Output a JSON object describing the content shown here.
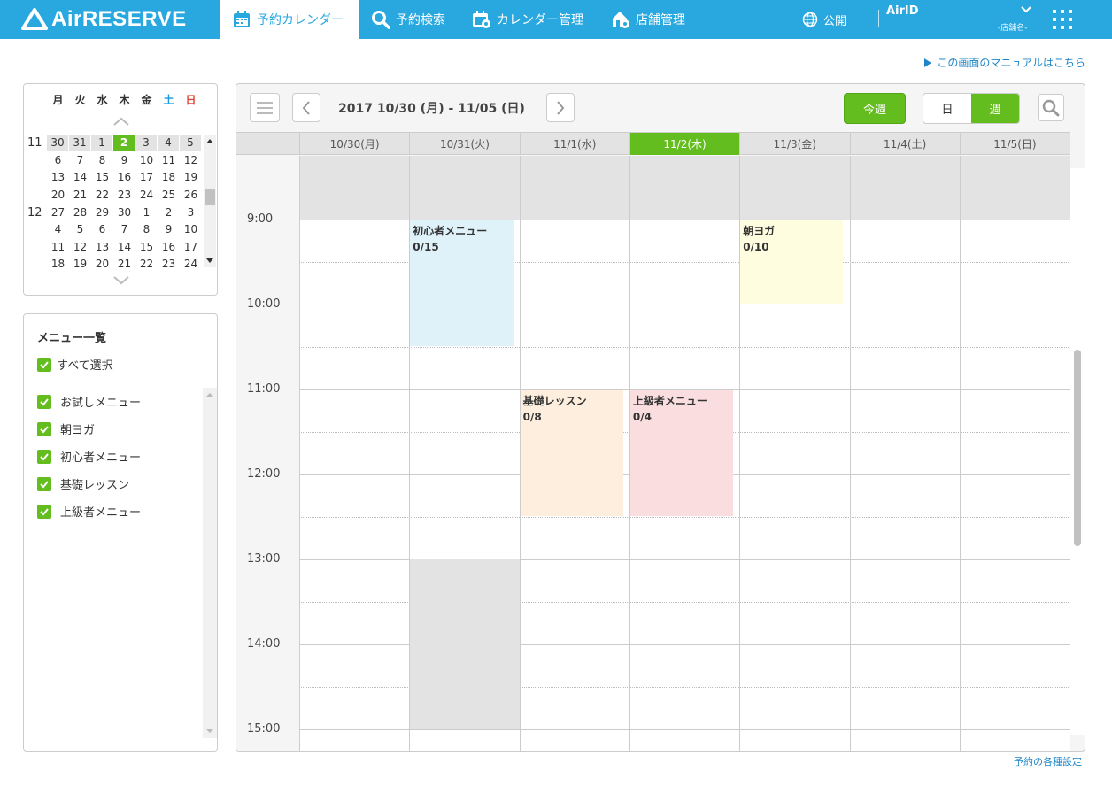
{
  "header": {
    "logo_text": "AirRESERVE",
    "nav": [
      {
        "label": "予約カレンダー",
        "icon": "calendar-icon",
        "active": true
      },
      {
        "label": "予約検索",
        "icon": "search-icon",
        "active": false
      },
      {
        "label": "カレンダー管理",
        "icon": "calendar-gear-icon",
        "active": false
      },
      {
        "label": "店舗管理",
        "icon": "store-gear-icon",
        "active": false
      }
    ],
    "publish_label": "公開",
    "airid_label": "AirID",
    "store_label": "-店舗名-"
  },
  "manual_link": "この画面のマニュアルはこちら",
  "settings_link": "予約の各種設定",
  "mini_calendar": {
    "weekdays": [
      "月",
      "火",
      "水",
      "木",
      "金",
      "土",
      "日"
    ],
    "rows": [
      {
        "month": "11",
        "days": [
          "30",
          "31",
          "1",
          "2",
          "3",
          "4",
          "5"
        ]
      },
      {
        "month": "",
        "days": [
          "6",
          "7",
          "8",
          "9",
          "10",
          "11",
          "12"
        ]
      },
      {
        "month": "",
        "days": [
          "13",
          "14",
          "15",
          "16",
          "17",
          "18",
          "19"
        ]
      },
      {
        "month": "",
        "days": [
          "20",
          "21",
          "22",
          "23",
          "24",
          "25",
          "26"
        ]
      },
      {
        "month": "12",
        "days": [
          "27",
          "28",
          "29",
          "30",
          "1",
          "2",
          "3"
        ]
      },
      {
        "month": "",
        "days": [
          "4",
          "5",
          "6",
          "7",
          "8",
          "9",
          "10"
        ]
      },
      {
        "month": "",
        "days": [
          "11",
          "12",
          "13",
          "14",
          "15",
          "16",
          "17"
        ]
      },
      {
        "month": "",
        "days": [
          "18",
          "19",
          "20",
          "21",
          "22",
          "23",
          "24"
        ]
      }
    ],
    "today": "2"
  },
  "menu_list": {
    "title": "メニュー一覧",
    "select_all": "すべて選択",
    "items": [
      "お試しメニュー",
      "朝ヨガ",
      "初心者メニュー",
      "基礎レッスン",
      "上級者メニュー"
    ]
  },
  "calendar": {
    "range_label": "2017 10/30 (月) - 11/05 (日)",
    "today_button": "今週",
    "view_day": "日",
    "view_week": "週",
    "days": [
      "10/30(月)",
      "10/31(火)",
      "11/1(水)",
      "11/2(木)",
      "11/3(金)",
      "11/4(土)",
      "11/5(日)"
    ],
    "today_index": 3,
    "hours": [
      "9:00",
      "10:00",
      "11:00",
      "12:00",
      "13:00",
      "14:00",
      "15:00"
    ],
    "events": [
      {
        "day": 1,
        "start": "9:00",
        "end": "10:30",
        "name": "初心者メニュー",
        "capacity": "0/15",
        "color": "#dff2fa"
      },
      {
        "day": 4,
        "start": "9:00",
        "end": "10:00",
        "name": "朝ヨガ",
        "capacity": "0/10",
        "color": "#fefde0"
      },
      {
        "day": 2,
        "start": "11:00",
        "end": "12:30",
        "name": "基礎レッスン",
        "capacity": "0/8",
        "color": "#fdeedd"
      },
      {
        "day": 3,
        "start": "11:00",
        "end": "12:30",
        "name": "上級者メニュー",
        "capacity": "0/4",
        "color": "#fadedf"
      }
    ]
  },
  "colors": {
    "header_blue": "#29a8e0",
    "accent_green": "#64bd1f",
    "link_blue": "#1f86c8"
  }
}
